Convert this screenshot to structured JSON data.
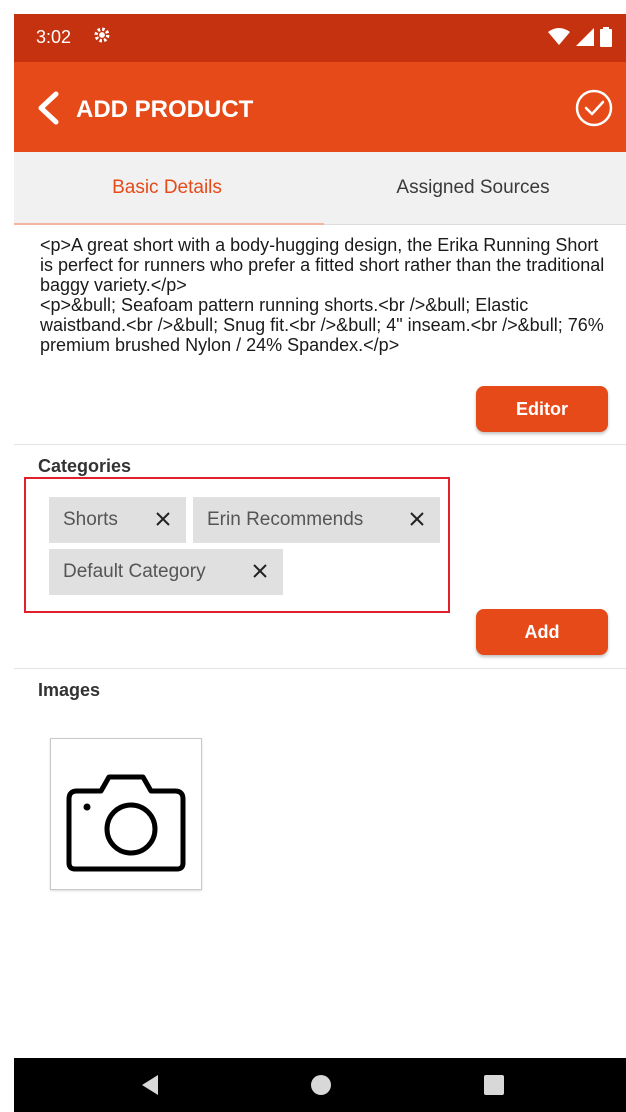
{
  "status_bar": {
    "time": "3:02",
    "icons": [
      "gear-icon",
      "wifi-icon",
      "signal-icon",
      "battery-icon"
    ]
  },
  "app_bar": {
    "title": "ADD PRODUCT",
    "back_icon": "chevron-left-icon",
    "confirm_icon": "check-circle-icon"
  },
  "tabs": [
    {
      "label": "Basic Details",
      "active": true
    },
    {
      "label": "Assigned Sources",
      "active": false
    }
  ],
  "description": {
    "text": "<p>A great short with a body-hugging design, the Erika Running Short is perfect for runners who prefer a fitted short rather than the traditional baggy variety.</p>\n<p>&bull; Seafoam pattern running shorts.<br />&bull; Elastic waistband.<br />&bull; Snug fit.<br />&bull; 4\" inseam.<br />&bull; 76% premium brushed Nylon / 24% Spandex.</p>",
    "editor_button": "Editor"
  },
  "categories": {
    "label": "Categories",
    "chips": [
      {
        "label": "Shorts"
      },
      {
        "label": "Erin Recommends"
      },
      {
        "label": "Default Category"
      }
    ],
    "add_button": "Add"
  },
  "images": {
    "label": "Images",
    "placeholder_icon": "camera-icon"
  },
  "nav_bar": {
    "icons": [
      "back-triangle-icon",
      "home-circle-icon",
      "recents-square-icon"
    ]
  },
  "colors": {
    "status_bar": "#c4320f",
    "app_bar": "#e64a19",
    "accent": "#e64a19",
    "highlight_border": "#e0202a"
  }
}
